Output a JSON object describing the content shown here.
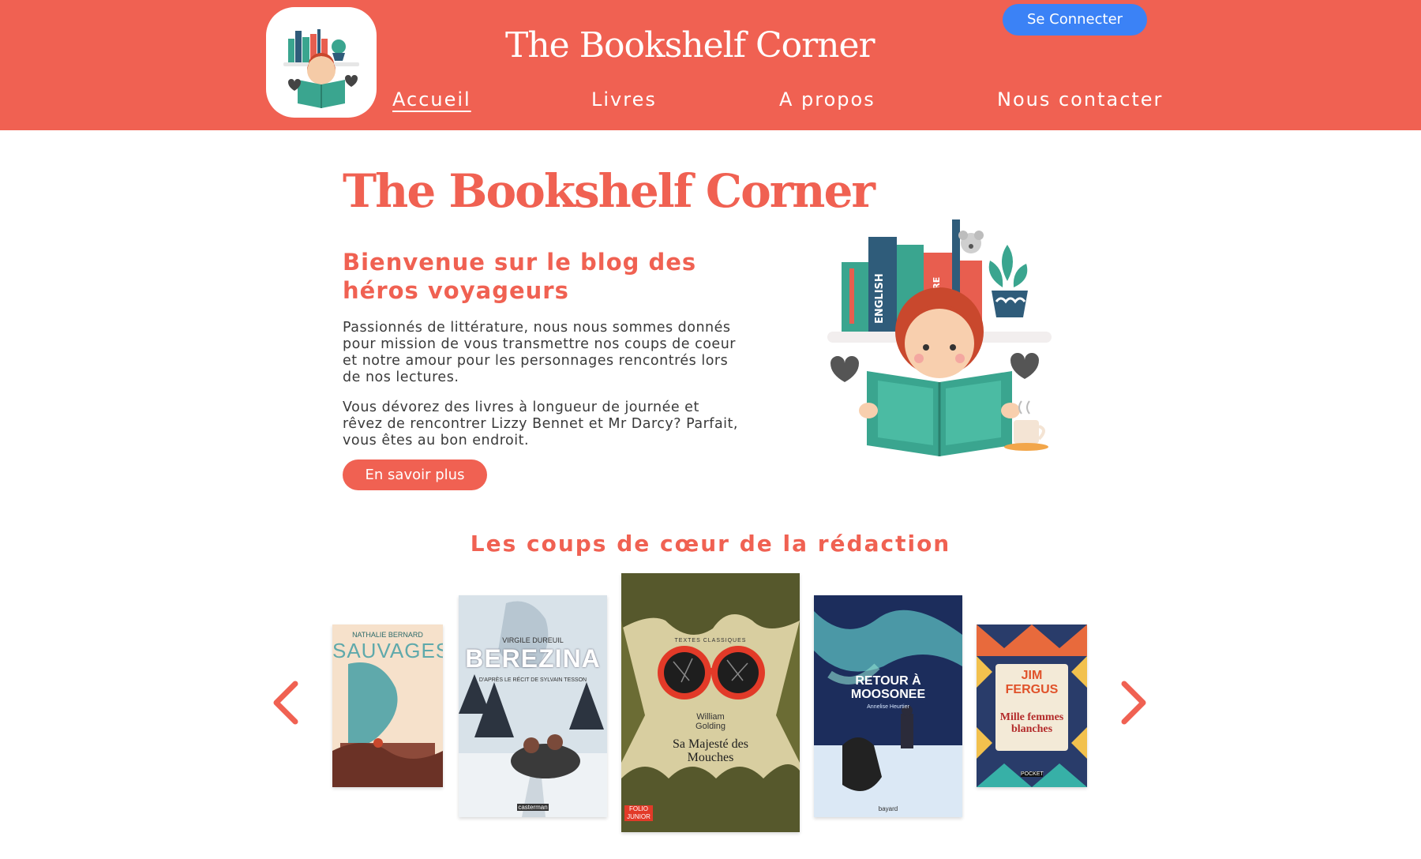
{
  "header": {
    "site_title": "The Bookshelf Corner",
    "login_label": "Se Connecter",
    "nav": [
      "Accueil",
      "Livres",
      "A propos",
      "Nous contacter"
    ],
    "active_nav": "Accueil"
  },
  "hero": {
    "title": "The Bookshelf Corner",
    "subtitle": "Bienvenue sur le blog des héros voyageurs",
    "paragraph1": "Passionnés de littérature, nous nous sommes donnés pour mission de vous transmettre nos coups de coeur et notre amour pour les personnages rencontrés lors de nos lectures.",
    "paragraph2": "Vous dévorez des livres à longueur de journée et rêvez de rencontrer Lizzy Bennet et Mr Darcy? Parfait, vous êtes au bon endroit.",
    "cta_label": "En savoir plus",
    "illustration_spines": [
      "ENGLISH",
      "NATURE"
    ]
  },
  "favorites": {
    "title": "Les coups de cœur de la rédaction",
    "books": [
      {
        "author": "NATHALIE BERNARD",
        "title": "SAUVAGES"
      },
      {
        "author": "VIRGILE DUREUIL",
        "title": "BEREZINA",
        "subtitle": "D'APRÈS LE RÉCIT DE SYLVAIN TESSON",
        "publisher": "casterman"
      },
      {
        "series": "TEXTES CLASSIQUES",
        "author": "William Golding",
        "title": "Sa Majesté des Mouches",
        "publisher": "FOLIO JUNIOR"
      },
      {
        "title": "RETOUR À MOOSONEE",
        "author": "Annelise Heurtier",
        "publisher": "bayard"
      },
      {
        "author": "JIM FERGUS",
        "title": "Mille femmes blanches",
        "publisher": "POCKET"
      }
    ]
  },
  "colors": {
    "brand": "#f06152",
    "login_button": "#3b82f6",
    "teal": "#3aa58f"
  },
  "icons": {
    "prev": "chevron-left-icon",
    "next": "chevron-right-icon"
  }
}
